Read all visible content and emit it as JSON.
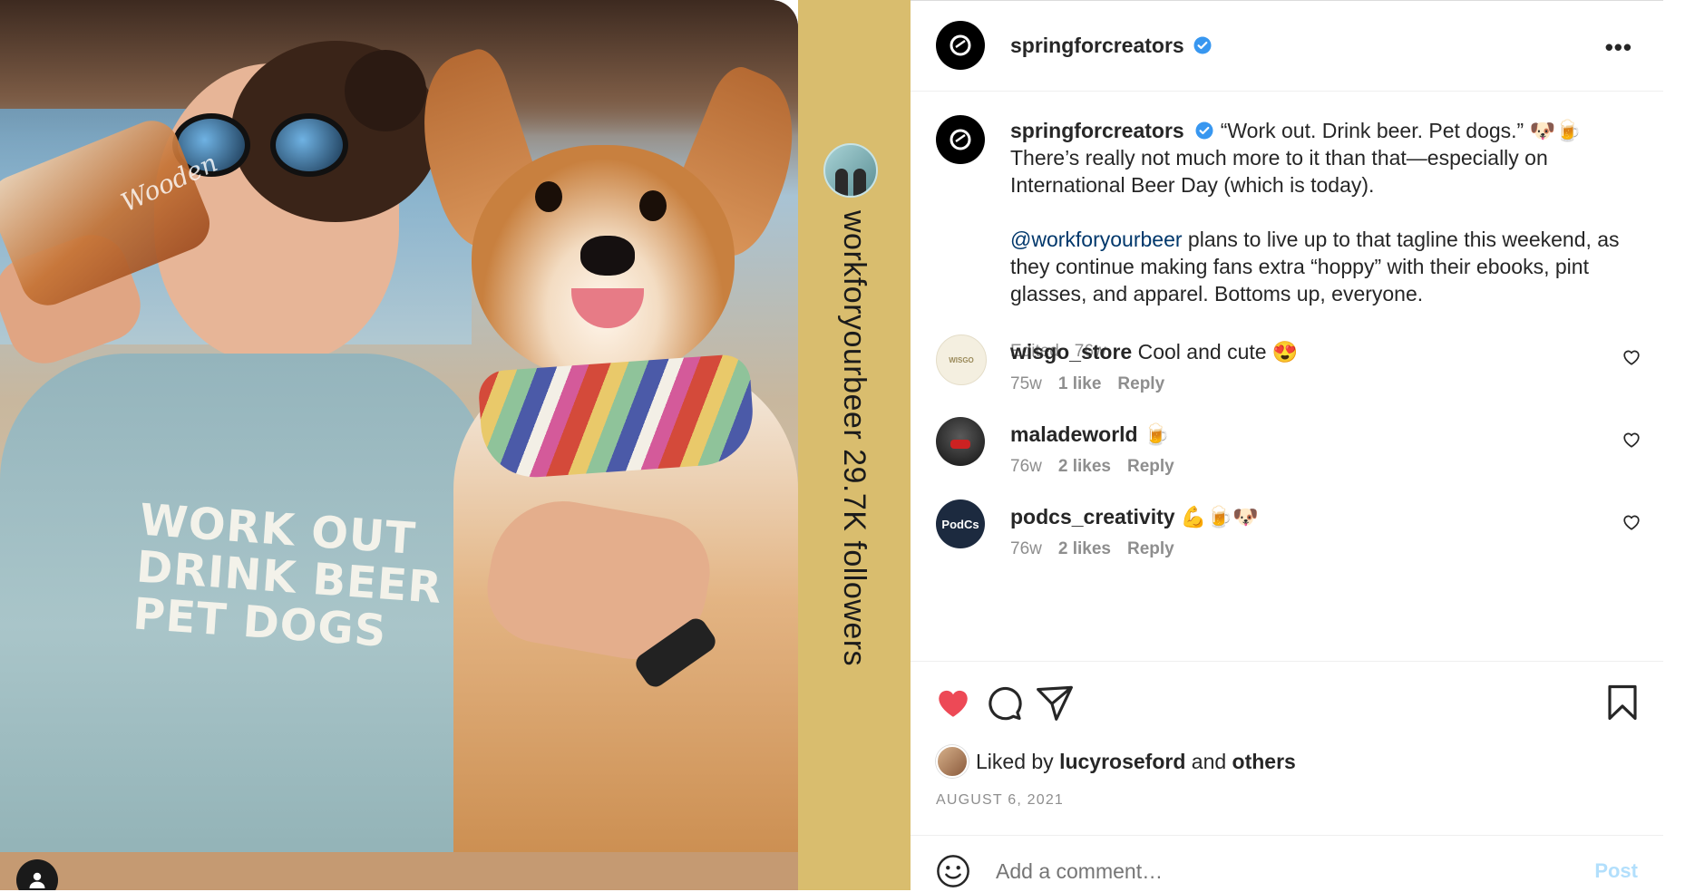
{
  "post": {
    "gold_strip": {
      "text": "workforyourbeer 29.7K followers",
      "color": "#d9bd6e"
    },
    "photo": {
      "shirt_text": "WORK OUT\nDRINK BEER\nPET DOGS",
      "glass_text": "Wooden"
    }
  },
  "header": {
    "username": "springforcreators",
    "verified": true,
    "more_label": "•••"
  },
  "caption": {
    "username": "springforcreators",
    "text_1": "“Work out. Drink beer. Pet dogs.” 🐶🍺 There’s really not much more to it than that—especially on International Beer Day (which is today).",
    "mention": "@workforyourbeer",
    "text_2": " plans to live up to that tagline this weekend, as they continue making fans extra “hoppy” with their ebooks, pint glasses, and apparel. Bottoms up, everyone.",
    "meta": "Edited · 76w"
  },
  "comments": [
    {
      "username": "wisgo_store",
      "text": "Cool and cute 😍",
      "time": "75w",
      "likes": "1 like",
      "reply": "Reply",
      "avatar_text": "WISGO"
    },
    {
      "username": "maladeworld",
      "text": "🍺",
      "time": "76w",
      "likes": "2 likes",
      "reply": "Reply"
    },
    {
      "username": "podcs_creativity",
      "text": "💪🍺🐶",
      "time": "76w",
      "likes": "2 likes",
      "reply": "Reply",
      "avatar_text": "PodCs"
    }
  ],
  "likes": {
    "prefix": "Liked by ",
    "user": "lucyroseford",
    "middle": " and ",
    "others": "others"
  },
  "date": "AUGUST 6, 2021",
  "add_comment": {
    "placeholder": "Add a comment…",
    "post_label": "Post"
  },
  "colors": {
    "like_red": "#ed4956",
    "verified_blue": "#3897f0",
    "link": "#00376b",
    "muted": "#8e8e8e",
    "post_disabled": "#b2dffc"
  }
}
